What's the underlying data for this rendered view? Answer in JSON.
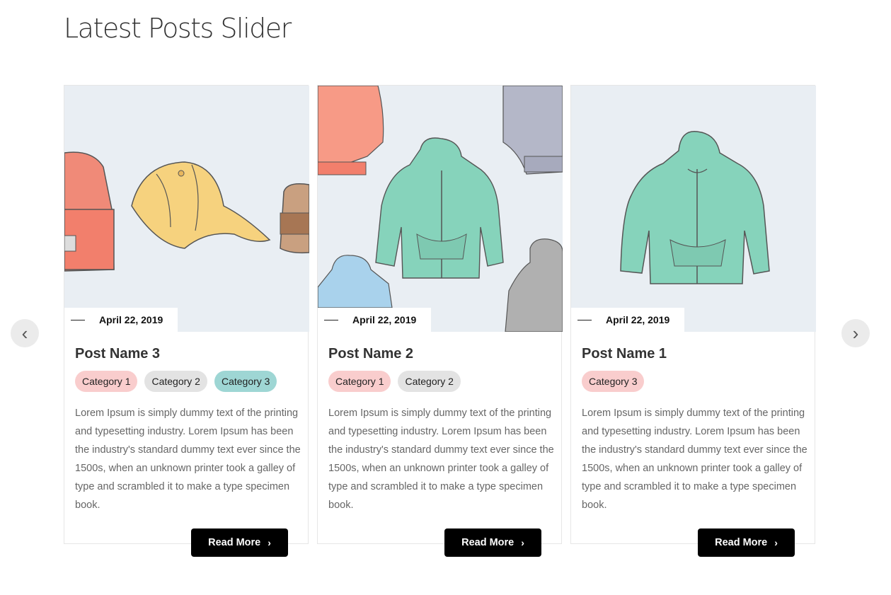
{
  "page": {
    "title": "Latest Posts Slider"
  },
  "slider": {
    "prev_icon": "chevron-left-icon",
    "next_icon": "chevron-right-icon",
    "prev_glyph": "‹",
    "next_glyph": "›",
    "posts": [
      {
        "date": "April 22, 2019",
        "title": "Post Name 3",
        "image": "hats-illustration",
        "categories": [
          "Category 1",
          "Category 2",
          "Category 3"
        ],
        "excerpt": "Lorem Ipsum is simply dummy text of the printing and typesetting industry. Lorem Ipsum has been the industry's standard dummy text ever since the 1500s, when an unknown printer took a galley of type and scrambled it to make a type specimen book.",
        "read_more": "Read More"
      },
      {
        "date": "April 22, 2019",
        "title": "Post Name 2",
        "image": "hoodies-pattern-illustration",
        "categories": [
          "Category 1",
          "Category 2"
        ],
        "excerpt": "Lorem Ipsum is simply dummy text of the printing and typesetting industry. Lorem Ipsum has been the industry's standard dummy text ever since the 1500s, when an unknown printer took a galley of type and scrambled it to make a type specimen book.",
        "read_more": "Read More"
      },
      {
        "date": "April 22, 2019",
        "title": "Post Name 1",
        "image": "hoodie-illustration",
        "categories": [
          "Category 3"
        ],
        "excerpt": "Lorem Ipsum is simply dummy text of the printing and typesetting industry. Lorem Ipsum has been the industry's standard dummy text ever since the 1500s, when an unknown printer took a galley of type and scrambled it to make a type specimen book.",
        "read_more": "Read More"
      }
    ]
  },
  "colors": {
    "category_1": "#f9cdcd",
    "category_2": "#e3e3e3",
    "category_3": "#9ed6d4",
    "button": "#000000",
    "image_bg": "#e9eef3"
  }
}
